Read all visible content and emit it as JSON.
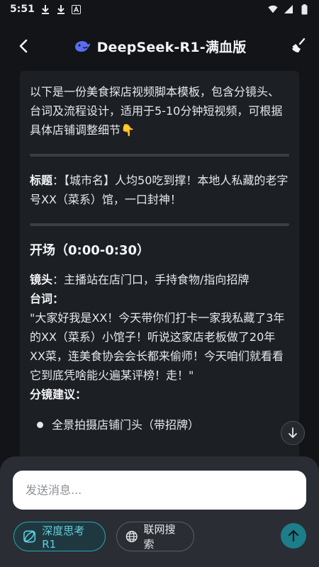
{
  "status_bar": {
    "time": "5:51",
    "icons_left": [
      "download-icon",
      "download-icon",
      "text-icon"
    ],
    "icons_right": [
      "wifi-icon",
      "signal-icon",
      "battery-icon"
    ]
  },
  "header": {
    "title": "DeepSeek-R1-满血版",
    "logo_icon": "whale-icon",
    "back_icon": "back-icon",
    "right_icon": "broom-icon"
  },
  "messages": {
    "intro": "以下是一份美食探店视频脚本模板，包含分镜头、台词及流程设计，适用于5-10分钟短视频，可根据具体店铺调整细节👇",
    "title_label": "标题",
    "title_text": "：【城市名】人均50吃到撑！本地人私藏的老字号XX（菜系）馆，一口封神！",
    "section_1_title": "开场（0:00-0:30）",
    "shot_label": "镜头",
    "shot_text": "：主播站在店门口，手持食物/指向招牌",
    "line_label": "台词",
    "line_colon": "：",
    "line_text": "\"大家好我是XX！今天带你们打卡一家我私藏了3年的XX（菜系）小馆子！听说这家店老板做了20年XX菜，连美食协会会长都来偷师！今天咱们就看看它到底凭啥能火遍某评榜！走！\"",
    "storyboard_label": "分镜建议",
    "storyboard_colon": "：",
    "bullet_1": "全景拍摄店铺门头（带招牌）"
  },
  "composer": {
    "placeholder": "发送消息...",
    "deep_think_label": "深度思考R1",
    "web_search_label": "联网搜索"
  },
  "colors": {
    "background": "#121417",
    "card": "#1c1f24",
    "composer": "#2a2d33",
    "accent": "#2aa6b4",
    "send": "#1c7e88"
  }
}
